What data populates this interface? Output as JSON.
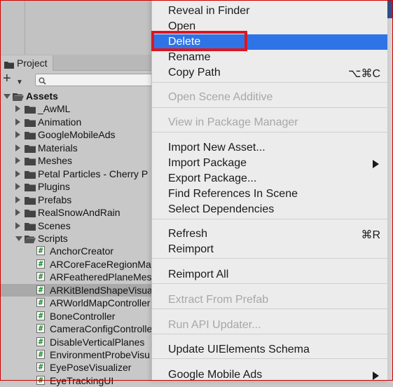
{
  "colors": {
    "menu_bg": "#ececec",
    "highlight": "#2f74e6",
    "annotation_red": "#e1141c",
    "panel_bg": "#c8c8c8"
  },
  "project_panel": {
    "tab_label": "Project",
    "add_icon": "plus-icon",
    "search_placeholder": ""
  },
  "tree": [
    {
      "label": "Assets",
      "kind": "folder",
      "expanded": true,
      "bold": true
    },
    {
      "label": "_AwML",
      "kind": "folder"
    },
    {
      "label": "Animation",
      "kind": "folder"
    },
    {
      "label": "GoogleMobileAds",
      "kind": "folder"
    },
    {
      "label": "Materials",
      "kind": "folder"
    },
    {
      "label": "Meshes",
      "kind": "folder"
    },
    {
      "label": "Petal Particles - Cherry P",
      "kind": "folder"
    },
    {
      "label": "Plugins",
      "kind": "folder"
    },
    {
      "label": "Prefabs",
      "kind": "folder"
    },
    {
      "label": "RealSnowAndRain",
      "kind": "folder"
    },
    {
      "label": "Scenes",
      "kind": "folder"
    },
    {
      "label": "Scripts",
      "kind": "folder",
      "expanded": true
    },
    {
      "label": "AnchorCreator",
      "kind": "script"
    },
    {
      "label": "ARCoreFaceRegionMa",
      "kind": "script"
    },
    {
      "label": "ARFeatheredPlaneMes",
      "kind": "script"
    },
    {
      "label": "ARKitBlendShapeVisua",
      "kind": "script",
      "selected": true
    },
    {
      "label": "ARWorldMapController",
      "kind": "script"
    },
    {
      "label": "BoneController",
      "kind": "script"
    },
    {
      "label": "CameraConfigControlle",
      "kind": "script"
    },
    {
      "label": "DisableVerticalPlanes",
      "kind": "script"
    },
    {
      "label": "EnvironmentProbeVisu",
      "kind": "script"
    },
    {
      "label": "EyePoseVisualizer",
      "kind": "script"
    },
    {
      "label": "EyeTrackingUI",
      "kind": "script"
    }
  ],
  "context_menu": {
    "items": [
      {
        "label": "Reveal in Finder"
      },
      {
        "label": "Open"
      },
      {
        "label": "Delete",
        "highlighted": true
      },
      {
        "label": "Rename"
      },
      {
        "label": "Copy Path",
        "shortcut": "⌥⌘C"
      },
      {
        "separator": true
      },
      {
        "label": "Open Scene Additive",
        "disabled": true
      },
      {
        "separator": true
      },
      {
        "label": "View in Package Manager",
        "disabled": true
      },
      {
        "separator": true
      },
      {
        "label": "Import New Asset..."
      },
      {
        "label": "Import Package",
        "submenu": true
      },
      {
        "label": "Export Package..."
      },
      {
        "label": "Find References In Scene"
      },
      {
        "label": "Select Dependencies"
      },
      {
        "separator": true
      },
      {
        "label": "Refresh",
        "shortcut": "⌘R"
      },
      {
        "label": "Reimport"
      },
      {
        "separator": true
      },
      {
        "label": "Reimport All"
      },
      {
        "separator": true
      },
      {
        "label": "Extract From Prefab",
        "disabled": true
      },
      {
        "separator": true
      },
      {
        "label": "Run API Updater...",
        "disabled": true
      },
      {
        "separator": true
      },
      {
        "label": "Update UIElements Schema"
      },
      {
        "separator": true
      },
      {
        "label": "Google Mobile Ads",
        "submenu": true
      }
    ]
  }
}
